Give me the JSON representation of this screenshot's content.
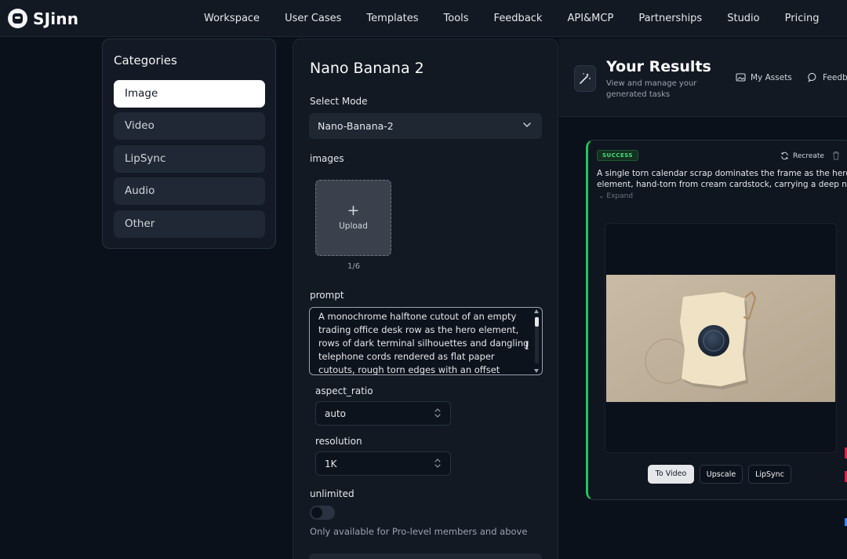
{
  "brand": {
    "name": "SJinn"
  },
  "nav": {
    "items": [
      "Workspace",
      "User Cases",
      "Templates",
      "Tools",
      "Feedback",
      "API&MCP",
      "Partnerships",
      "Studio",
      "Pricing"
    ]
  },
  "categories": {
    "title": "Categories",
    "items": [
      "Image",
      "Video",
      "LipSync",
      "Audio",
      "Other"
    ],
    "active": "Image"
  },
  "form": {
    "title": "Nano Banana 2",
    "select_mode_label": "Select Mode",
    "select_mode_value": "Nano-Banana-2",
    "images_label": "images",
    "upload_label": "Upload",
    "upload_count": "1/6",
    "prompt_label": "prompt",
    "prompt_value": "A monochrome halftone cutout of an empty trading office desk row as the hero element, rows of dark terminal silhouettes and dangling telephone cords rendered as flat paper cutouts, rough torn edges with an offset copper accent",
    "aspect_ratio_label": "aspect_ratio",
    "aspect_ratio_value": "auto",
    "resolution_label": "resolution",
    "resolution_value": "1K",
    "unlimited_label": "unlimited",
    "unlimited_on": false,
    "unlimited_note": "Only available for Pro-level members and above"
  },
  "results": {
    "title": "Your Results",
    "subtitle": "View and manage your generated tasks",
    "my_assets": "My Assets",
    "feedback": "Feedb",
    "card": {
      "status": "SUCCESS",
      "recreate": "Recreate",
      "description_line1": "A single torn calendar scrap dominates the frame as the hero",
      "description_line2": "element, hand-torn from cream cardstock, carrying a deep navy ...",
      "expand": "Expand",
      "buttons": [
        "To Video",
        "Upscale",
        "LipSync"
      ]
    }
  },
  "colors": {
    "background": "#0b111b",
    "panel": "#121923",
    "accent_success": "#22c55e",
    "active_category": "#ffffff"
  }
}
